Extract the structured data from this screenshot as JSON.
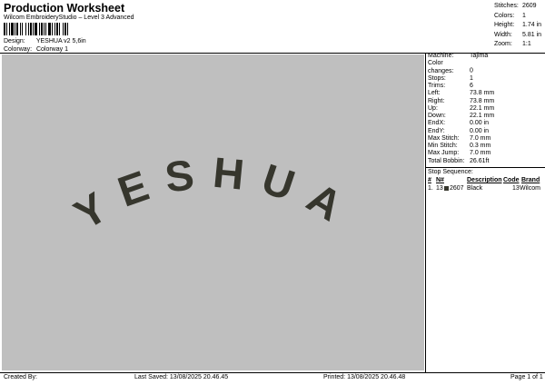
{
  "header": {
    "title": "Production Worksheet",
    "subtitle": "Wilcom EmbroideryStudio – Level 3 Advanced",
    "design_label": "Design:",
    "design_value": "YESHUA v2 5,6in",
    "colorway_label": "Colorway:",
    "colorway_value": "Colorway 1"
  },
  "stats": [
    {
      "label": "Stitches:",
      "value": "2609"
    },
    {
      "label": "Colors:",
      "value": "1"
    },
    {
      "label": "Height:",
      "value": "1.74 in"
    },
    {
      "label": "Width:",
      "value": "5.81 in"
    },
    {
      "label": "Zoom:",
      "value": "1:1"
    }
  ],
  "design_text": "YESHUA",
  "thread_color": "#36362d",
  "machine_info": [
    {
      "label": "Machine:",
      "value": "Tajima"
    },
    {
      "label": "Color changes:",
      "value": "0"
    },
    {
      "label": "Stops:",
      "value": "1"
    },
    {
      "label": "Trims:",
      "value": "6"
    },
    {
      "label": "Left:",
      "value": "73.8 mm"
    },
    {
      "label": "Right:",
      "value": "73.8 mm"
    },
    {
      "label": "Up:",
      "value": "22.1 mm"
    },
    {
      "label": "Down:",
      "value": "22.1 mm"
    },
    {
      "label": "EndX:",
      "value": "0.00 in"
    },
    {
      "label": "EndY:",
      "value": "0.00 in"
    },
    {
      "label": "Max Stitch:",
      "value": "7.0 mm"
    },
    {
      "label": "Min Stitch:",
      "value": "0.3 mm"
    },
    {
      "label": "Max Jump:",
      "value": "7.0 mm"
    },
    {
      "label": "Total Bobbin:",
      "value": "26.61ft"
    }
  ],
  "stop_sequence": {
    "title": "Stop Sequence:",
    "headers": [
      "#",
      "N#",
      "Description",
      "Code",
      "Brand"
    ],
    "rows": [
      {
        "num": "1.",
        "n": "13",
        "code_num": "2607",
        "desc": "Black",
        "code": "13",
        "brand": "Wilcom"
      }
    ]
  },
  "footer": {
    "created_by": "Created By:",
    "last_saved": "Last Saved: 13/08/2025 20.46.45",
    "printed": "Printed: 13/08/2025 20.46.48",
    "page": "Page 1 of 1"
  }
}
